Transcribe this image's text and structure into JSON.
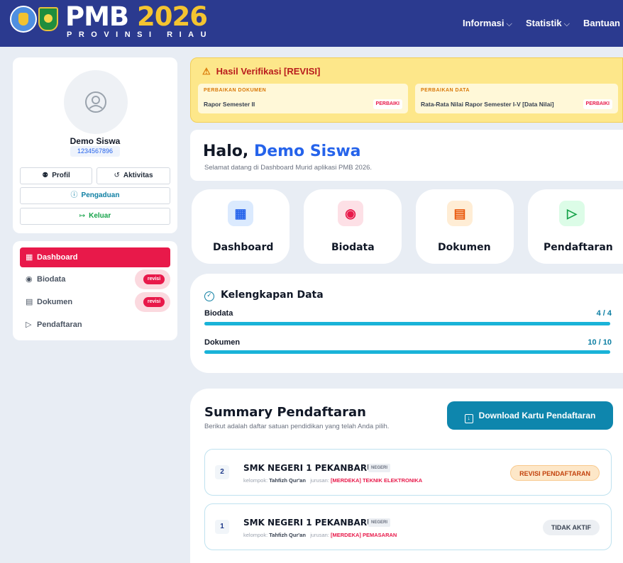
{
  "header": {
    "brand_main": "PMB",
    "brand_year": "2026",
    "brand_sub": "PROVINSI RIAU",
    "nav": [
      {
        "label": "Informasi",
        "has_dropdown": true
      },
      {
        "label": "Statistik",
        "has_dropdown": true
      },
      {
        "label": "Bantuan",
        "has_dropdown": false
      }
    ],
    "colors": {
      "bar": "#2b3a8f",
      "year": "#f4c430"
    }
  },
  "profile": {
    "name": "Demo Siswa",
    "id": "1234567896",
    "buttons": {
      "profil": "Profil",
      "aktivitas": "Aktivitas",
      "pengaduan": "Pengaduan",
      "keluar": "Keluar"
    }
  },
  "sidebar": {
    "items": [
      {
        "label": "Dashboard",
        "icon": "grid-icon",
        "active": true,
        "badge": ""
      },
      {
        "label": "Biodata",
        "icon": "user-circle-icon",
        "active": false,
        "badge": "revisi"
      },
      {
        "label": "Dokumen",
        "icon": "document-icon",
        "active": false,
        "badge": "revisi"
      },
      {
        "label": "Pendaftaran",
        "icon": "send-icon",
        "active": false,
        "badge": ""
      }
    ],
    "active_color": "#e8194a"
  },
  "alert": {
    "title": "Hasil Verifikasi [REVISI]",
    "boxes": [
      {
        "label": "PERBAIKAN DOKUMEN",
        "text": "Rapor Semester II",
        "action": "PERBAIKI"
      },
      {
        "label": "PERBAIKAN DATA",
        "text": "Rata-Rata Nilai Rapor Semester I-V [Data Nilai]",
        "action": "PERBAIKI"
      }
    ]
  },
  "greeting": {
    "prefix": "Halo,",
    "name": "Demo Siswa",
    "subtitle": "Selamat datang di Dashboard Murid aplikasi PMB 2026."
  },
  "quick_links": [
    {
      "label": "Dashboard",
      "icon": "grid-icon"
    },
    {
      "label": "Biodata",
      "icon": "user-circle-icon"
    },
    {
      "label": "Dokumen",
      "icon": "document-icon"
    },
    {
      "label": "Pendaftaran",
      "icon": "send-icon"
    }
  ],
  "completeness": {
    "title": "Kelengkapan Data",
    "rows": [
      {
        "label": "Biodata",
        "value": "4 / 4",
        "fraction": 1.0
      },
      {
        "label": "Dokumen",
        "value": "10 / 10",
        "fraction": 1.0
      }
    ]
  },
  "summary": {
    "title": "Summary Pendaftaran",
    "subtitle": "Berikut adalah daftar satuan pendidikan yang telah Anda pilih.",
    "download_label": "Download Kartu Pendaftaran",
    "registrations": [
      {
        "rank": "2",
        "school": "SMK NEGERI 1 PEKANBARU",
        "type": "NEGERI",
        "kelompok_label": "kelompok:",
        "kelompok": "Tahfizh Qur'an",
        "jurusan_label": "jurusan:",
        "jurusan": "[MERDEKA] TEKNIK ELEKTRONIKA",
        "status": "REVISI PENDAFTARAN"
      },
      {
        "rank": "1",
        "school": "SMK NEGERI 1 PEKANBARU",
        "type": "NEGERI",
        "kelompok_label": "kelompok:",
        "kelompok": "Tahfizh Qur'an",
        "jurusan_label": "jurusan:",
        "jurusan": "[MERDEKA] PEMASARAN",
        "status": "TIDAK AKTIF"
      }
    ]
  }
}
